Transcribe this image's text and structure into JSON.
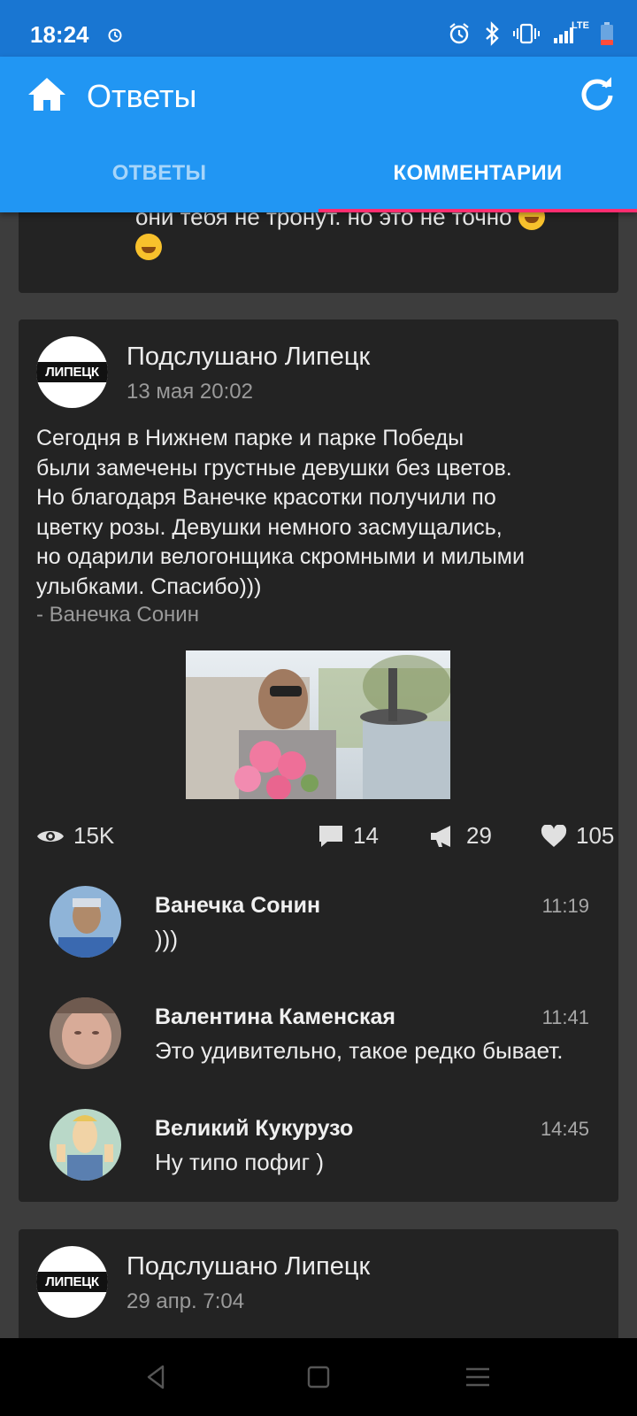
{
  "status_bar": {
    "time": "18:24",
    "icons": [
      "alarm-icon",
      "bluetooth-icon",
      "vibrate-icon",
      "signal-icon",
      "battery-icon"
    ],
    "network_label": "LTE"
  },
  "app_bar": {
    "title": "Ответы",
    "tabs": [
      {
        "label": "ОТВЕТЫ",
        "active": false
      },
      {
        "label": "КОММЕНТАРИИ",
        "active": true
      }
    ],
    "accent_color": "#2196f3",
    "indicator_color": "#ff2d6f"
  },
  "previous_post": {
    "text_tail": "они тебя не тронут. но это не точно"
  },
  "post": {
    "group_name": "Подслушано Липецк",
    "group_logo_text": "ЛИПЕЦК",
    "date": "13 мая 20:02",
    "text_lines": [
      "Сегодня в Нижнем парке и парке Победы",
      "были замечены грустные девушки без цветов.",
      "Но благодаря Ванечке красотки получили по",
      "цветку розы. Девушки немного засмущались,",
      "но одарили велогонщика скромными и милыми",
      "улыбками. Спасибо)))"
    ],
    "signature": "- Ванечка Сонин",
    "stats": {
      "views": "15K",
      "comments": "14",
      "reposts": "29",
      "likes": "105"
    },
    "comments": [
      {
        "author": "Ванечка Сонин",
        "time": "11:19",
        "text": ")))"
      },
      {
        "author": "Валентина Каменская",
        "time": "11:41",
        "text": "Это удивительно, такое редко бывает."
      },
      {
        "author": "Великий Кукурузо",
        "time": "14:45",
        "text": "Ну типо пофиг )"
      }
    ]
  },
  "next_post": {
    "group_name": "Подслушано Липецк",
    "group_logo_text": "ЛИПЕЦК",
    "date": "29 апр. 7:04"
  }
}
